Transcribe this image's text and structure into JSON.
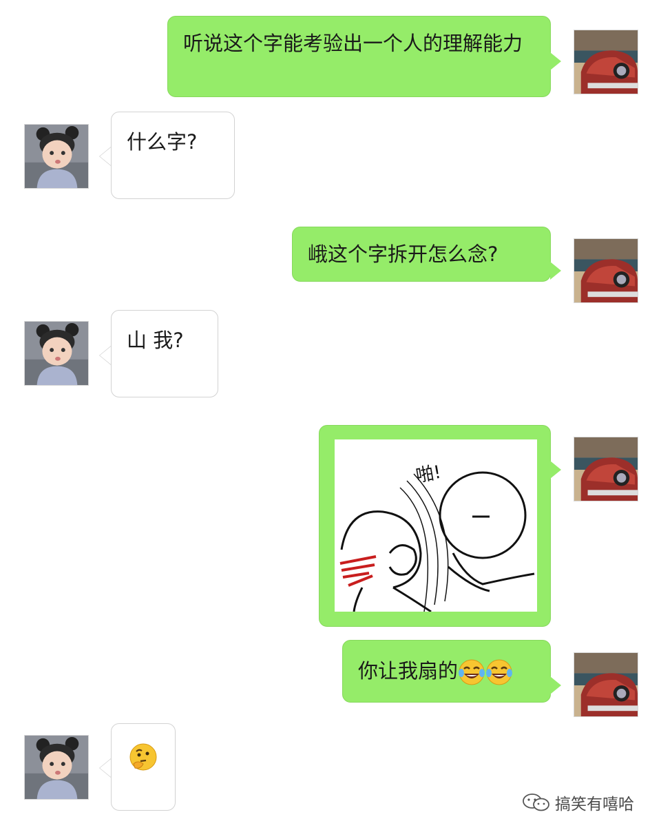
{
  "messages": [
    {
      "from": "me",
      "type": "text",
      "text": "听说这个字能考验出一个人的理解能力"
    },
    {
      "from": "friend",
      "type": "text",
      "text": "什么字?"
    },
    {
      "from": "me",
      "type": "text",
      "text": "峨这个字拆开怎么念?"
    },
    {
      "from": "friend",
      "type": "text",
      "text": "山 我?"
    },
    {
      "from": "me",
      "type": "image",
      "image_text": "啪!",
      "icon": "slap-sticker"
    },
    {
      "from": "me",
      "type": "text",
      "text": "你让我扇的",
      "emojis": [
        "tears-of-joy-emoji",
        "tears-of-joy-emoji"
      ]
    },
    {
      "from": "friend",
      "type": "emoji",
      "icon": "thinking-face-emoji"
    }
  ],
  "avatars": {
    "me": "car-avatar",
    "friend": "child-avatar"
  },
  "watermark": {
    "text": "搞笑有嘻哈",
    "icon": "wechat-logo-icon"
  },
  "colors": {
    "outgoing_bubble": "#95ec69",
    "incoming_bubble": "#ffffff",
    "background": "#ffffff"
  }
}
